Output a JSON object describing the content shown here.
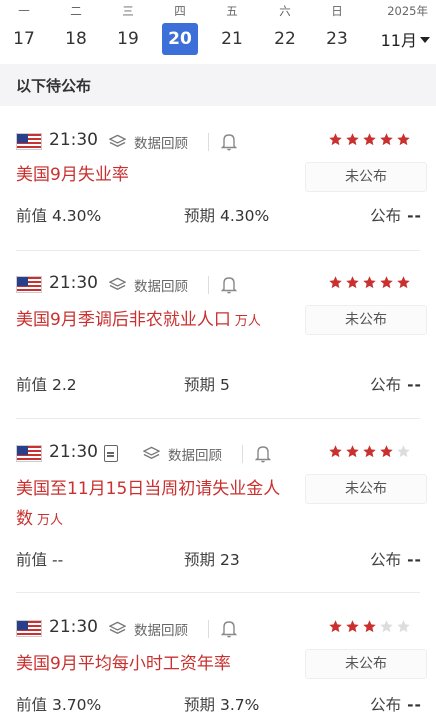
{
  "calendar": {
    "year": "2025年",
    "month": "11月",
    "days": [
      {
        "weekday": "一",
        "date": "17",
        "selected": false
      },
      {
        "weekday": "二",
        "date": "18",
        "selected": false
      },
      {
        "weekday": "三",
        "date": "19",
        "selected": false
      },
      {
        "weekday": "四",
        "date": "20",
        "selected": true
      },
      {
        "weekday": "五",
        "date": "21",
        "selected": false
      },
      {
        "weekday": "六",
        "date": "22",
        "selected": false
      },
      {
        "weekday": "日",
        "date": "23",
        "selected": false
      }
    ]
  },
  "section": {
    "title": "以下待公布"
  },
  "labels": {
    "history": "数据回顾",
    "previous": "前值",
    "forecast": "预期",
    "publish": "公布",
    "publish_value": "--",
    "status": "未公布"
  },
  "colors": {
    "accent": "#3d6fd9",
    "red": "#c8312f",
    "star_empty": "#dddddd"
  },
  "events": [
    {
      "time": "21:30",
      "country_flag": "us-flag-icon",
      "title": "美国9月失业率",
      "unit": "",
      "importance": 5,
      "previous": "4.30%",
      "forecast": "4.30%",
      "has_doc": false
    },
    {
      "time": "21:30",
      "country_flag": "us-flag-icon",
      "title": "美国9月季调后非农就业人口",
      "unit": "万人",
      "importance": 5,
      "previous": "2.2",
      "forecast": "5",
      "has_doc": false
    },
    {
      "time": "21:30",
      "country_flag": "us-flag-icon",
      "title": "美国至11月15日当周初请失业金人数",
      "unit": "万人",
      "importance": 4,
      "previous": "--",
      "forecast": "23",
      "has_doc": true
    },
    {
      "time": "21:30",
      "country_flag": "us-flag-icon",
      "title": "美国9月平均每小时工资年率",
      "unit": "",
      "importance": 3,
      "previous": "3.70%",
      "forecast": "3.7%",
      "has_doc": false
    }
  ]
}
